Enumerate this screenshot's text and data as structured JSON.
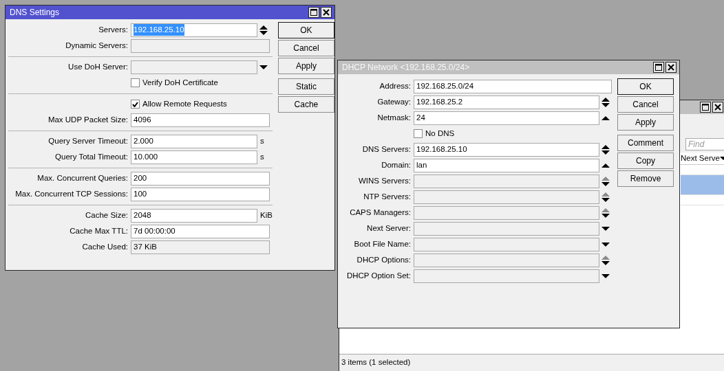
{
  "network_list": {
    "active": false,
    "find": {
      "placeholder": "Find"
    },
    "columns": [
      "Next Serve"
    ],
    "rows": [
      {
        "selected": false
      },
      {
        "selected": true
      },
      {
        "selected": false
      }
    ],
    "status_bar": "3 items (1 selected)"
  },
  "dns_settings": {
    "title": "DNS Settings",
    "active": true,
    "rows": [
      {
        "kind": "field",
        "label": "Servers:",
        "value": "192.168.25.10",
        "text_selected": true,
        "disabled": false,
        "control": {
          "kind": "spin",
          "dimmed": false
        }
      },
      {
        "kind": "field",
        "label": "Dynamic Servers:",
        "disabled": true
      },
      {
        "kind": "separator"
      },
      {
        "kind": "field",
        "label": "Use DoH Server:",
        "disabled": true,
        "control": {
          "kind": "dropdown"
        }
      },
      {
        "kind": "checkbox",
        "label": "Verify DoH Certificate",
        "checked": false
      },
      {
        "kind": "separator"
      },
      {
        "kind": "checkbox",
        "label": "Allow Remote Requests",
        "checked": true
      },
      {
        "kind": "field",
        "label": "Max UDP Packet Size:",
        "value": "4096",
        "text_selected": false,
        "disabled": false
      },
      {
        "kind": "separator"
      },
      {
        "kind": "field",
        "label": "Query Server Timeout:",
        "value": "2.000",
        "text_selected": false,
        "disabled": false,
        "unit": "s"
      },
      {
        "kind": "field",
        "label": "Query Total Timeout:",
        "value": "10.000",
        "text_selected": false,
        "disabled": false,
        "unit": "s"
      },
      {
        "kind": "separator"
      },
      {
        "kind": "field",
        "label": "Max. Concurrent Queries:",
        "value": "200",
        "text_selected": false,
        "disabled": false
      },
      {
        "kind": "field",
        "label": "Max. Concurrent TCP Sessions:",
        "value": "100",
        "text_selected": false,
        "disabled": false
      },
      {
        "kind": "separator"
      },
      {
        "kind": "field",
        "label": "Cache Size:",
        "value": "2048",
        "text_selected": false,
        "disabled": false,
        "unit": "KiB"
      },
      {
        "kind": "field",
        "label": "Cache Max TTL:",
        "value": "7d 00:00:00",
        "text_selected": false,
        "disabled": false
      },
      {
        "kind": "field",
        "label": "Cache Used:",
        "value": "37 KiB",
        "text_selected": false,
        "disabled": true
      }
    ],
    "button_groups": [
      [
        {
          "label": "OK",
          "default": true
        },
        {
          "label": "Cancel",
          "default": false
        },
        {
          "label": "Apply",
          "default": false
        }
      ],
      [
        {
          "label": "Static",
          "default": false
        },
        {
          "label": "Cache",
          "default": false
        }
      ]
    ]
  },
  "dhcp_network": {
    "title": "DHCP Network <192.168.25.0/24>",
    "active": false,
    "rows": [
      {
        "kind": "field",
        "label": "Address:",
        "value": "192.168.25.0/24",
        "text_selected": false,
        "disabled": false
      },
      {
        "kind": "field",
        "label": "Gateway:",
        "value": "192.168.25.2",
        "text_selected": false,
        "disabled": false,
        "control": {
          "kind": "spin",
          "dimmed": false
        }
      },
      {
        "kind": "field",
        "label": "Netmask:",
        "value": "24",
        "text_selected": false,
        "disabled": false,
        "control": {
          "kind": "up"
        }
      },
      {
        "kind": "checkbox",
        "label": "No DNS",
        "checked": false
      },
      {
        "kind": "field",
        "label": "DNS Servers:",
        "value": "192.168.25.10",
        "text_selected": false,
        "disabled": false,
        "control": {
          "kind": "spin",
          "dimmed": false
        }
      },
      {
        "kind": "field",
        "label": "Domain:",
        "value": "lan",
        "text_selected": false,
        "disabled": false,
        "control": {
          "kind": "up"
        }
      },
      {
        "kind": "field",
        "label": "WINS Servers:",
        "disabled": true,
        "control": {
          "kind": "spin",
          "dimmed": true
        }
      },
      {
        "kind": "field",
        "label": "NTP Servers:",
        "disabled": true,
        "control": {
          "kind": "spin",
          "dimmed": true
        }
      },
      {
        "kind": "field",
        "label": "CAPS Managers:",
        "disabled": true,
        "control": {
          "kind": "spin",
          "dimmed": true
        }
      },
      {
        "kind": "field",
        "label": "Next Server:",
        "disabled": true,
        "control": {
          "kind": "dropdown"
        }
      },
      {
        "kind": "field",
        "label": "Boot File Name:",
        "disabled": true,
        "control": {
          "kind": "dropdown"
        }
      },
      {
        "kind": "field",
        "label": "DHCP Options:",
        "disabled": true,
        "control": {
          "kind": "spin",
          "dimmed": true
        }
      },
      {
        "kind": "field",
        "label": "DHCP Option Set:",
        "disabled": true,
        "control": {
          "kind": "dropdown"
        }
      }
    ],
    "button_groups": [
      [
        {
          "label": "OK",
          "default": true
        },
        {
          "label": "Cancel",
          "default": false
        },
        {
          "label": "Apply",
          "default": false
        }
      ],
      [
        {
          "label": "Comment",
          "default": false
        },
        {
          "label": "Copy",
          "default": false
        },
        {
          "label": "Remove",
          "default": false
        }
      ]
    ]
  }
}
